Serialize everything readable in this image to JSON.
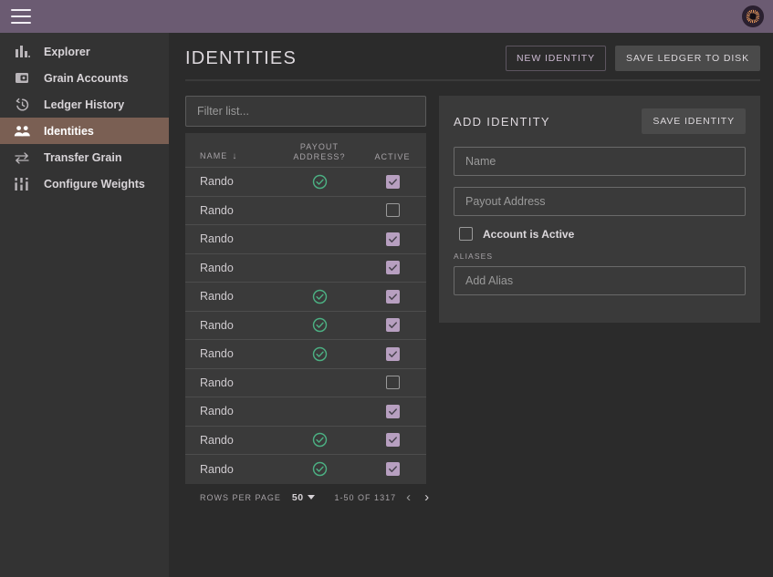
{
  "topbar": {
    "menu_icon": "hamburger-icon",
    "avatar_icon": "user-avatar-icon"
  },
  "sidebar": {
    "items": [
      {
        "label": "Explorer",
        "icon": "bar-chart-icon",
        "active": false
      },
      {
        "label": "Grain Accounts",
        "icon": "wallet-icon",
        "active": false
      },
      {
        "label": "Ledger History",
        "icon": "history-icon",
        "active": false
      },
      {
        "label": "Identities",
        "icon": "people-icon",
        "active": true
      },
      {
        "label": "Transfer Grain",
        "icon": "transfer-icon",
        "active": false
      },
      {
        "label": "Configure Weights",
        "icon": "sliders-icon",
        "active": false
      }
    ]
  },
  "header": {
    "title": "IDENTITIES",
    "new_identity_label": "NEW IDENTITY",
    "save_ledger_label": "SAVE LEDGER TO DISK"
  },
  "table": {
    "filter_placeholder": "Filter list...",
    "columns": {
      "name": "NAME",
      "sort_arrow": "↓",
      "payout_line1": "PAYOUT",
      "payout_line2": "ADDRESS?",
      "active": "ACTIVE"
    },
    "rows": [
      {
        "name": "Rando",
        "payout": true,
        "active": true
      },
      {
        "name": "Rando",
        "payout": false,
        "active": false
      },
      {
        "name": "Rando",
        "payout": false,
        "active": true
      },
      {
        "name": "Rando",
        "payout": false,
        "active": true
      },
      {
        "name": "Rando",
        "payout": true,
        "active": true
      },
      {
        "name": "Rando",
        "payout": true,
        "active": true
      },
      {
        "name": "Rando",
        "payout": true,
        "active": true
      },
      {
        "name": "Rando",
        "payout": false,
        "active": false
      },
      {
        "name": "Rando",
        "payout": false,
        "active": true
      },
      {
        "name": "Rando",
        "payout": true,
        "active": true
      },
      {
        "name": "Rando",
        "payout": true,
        "active": true
      }
    ],
    "footer": {
      "rows_per_page_label": "ROWS PER PAGE",
      "rows_per_page_value": "50",
      "range": "1-50 OF 1317",
      "prev_icon": "chevron-left-icon",
      "next_icon": "chevron-right-icon"
    }
  },
  "add_identity": {
    "title": "ADD IDENTITY",
    "save_label": "SAVE IDENTITY",
    "name_placeholder": "Name",
    "payout_placeholder": "Payout Address",
    "active_checkbox_label": "Account is Active",
    "active_checked": false,
    "aliases_label": "ALIASES",
    "alias_placeholder": "Add Alias"
  },
  "colors": {
    "topbar_purple": "#6b5b72",
    "sidebar": "#333333",
    "page_bg": "#2b2b2b",
    "surface": "#3a3a3a",
    "active_nav": "#7a5f53",
    "accent_purple": "#b79fc0",
    "check_green": "#4caf82"
  }
}
